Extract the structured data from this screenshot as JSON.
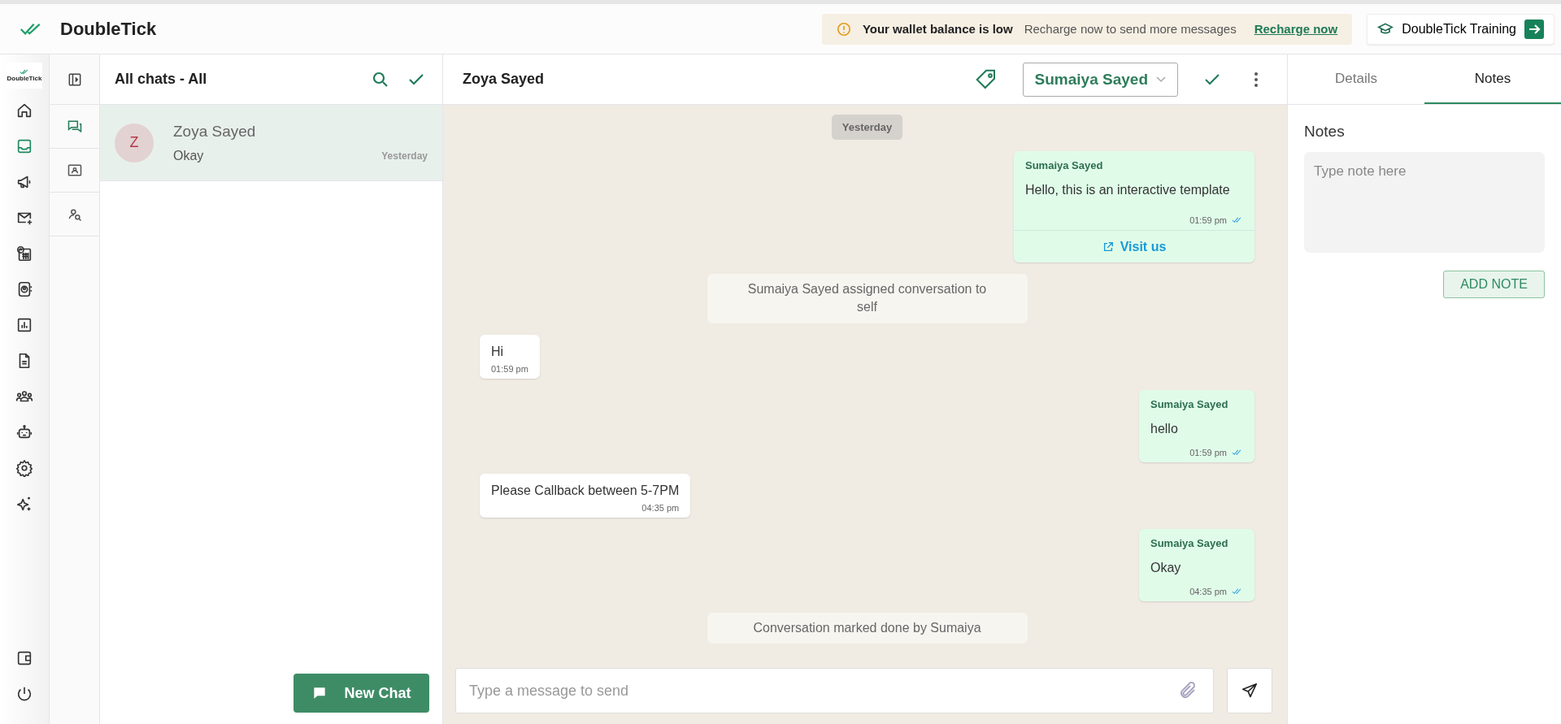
{
  "app": {
    "title": "DoubleTick",
    "logo_caption": "DoubleTick"
  },
  "banner": {
    "title": "Your wallet balance is low",
    "message": "Recharge now to send more messages",
    "link": "Recharge now"
  },
  "training_button": {
    "label": "DoubleTick Training"
  },
  "nav_rail": {
    "items": [
      {
        "selected": false
      },
      {
        "selected": true
      },
      {
        "selected": false
      },
      {
        "selected": false
      },
      {
        "selected": false
      },
      {
        "selected": false
      },
      {
        "selected": false
      },
      {
        "selected": false
      },
      {
        "selected": false
      },
      {
        "selected": false
      },
      {
        "selected": false
      },
      {
        "selected": false
      }
    ],
    "bottom_items": [
      {
        "selected": false
      },
      {
        "selected": false
      }
    ]
  },
  "sub_rail": {
    "items": [
      {
        "selected": true
      },
      {
        "selected": false
      },
      {
        "selected": false
      }
    ]
  },
  "chat_list": {
    "title": "All chats - All",
    "chats": [
      {
        "initial": "Z",
        "name": "Zoya Sayed",
        "preview": "Okay",
        "time": "Yesterday",
        "selected": true
      }
    ],
    "new_chat": "New Chat"
  },
  "conversation": {
    "contact": "Zoya Sayed",
    "assignee": "Sumaiya Sayed",
    "messages": [
      {
        "kind": "date",
        "text": "Yesterday"
      },
      {
        "kind": "outgoing",
        "sender": "Sumaiya Sayed",
        "text": "Hello, this is an interactive template",
        "time": "01:59 pm",
        "button": "Visit us"
      },
      {
        "kind": "system",
        "text": "Sumaiya Sayed assigned conversation to self"
      },
      {
        "kind": "incoming",
        "text": "Hi",
        "time": "01:59 pm"
      },
      {
        "kind": "outgoing",
        "sender": "Sumaiya Sayed",
        "text": "hello",
        "time": "01:59 pm"
      },
      {
        "kind": "incoming",
        "text": "Please Callback between 5-7PM",
        "time": "04:35 pm"
      },
      {
        "kind": "outgoing",
        "sender": "Sumaiya Sayed",
        "text": "Okay",
        "time": "04:35 pm"
      },
      {
        "kind": "system",
        "text": "Conversation marked done by Sumaiya"
      }
    ],
    "composer": {
      "placeholder": "Type a message to send"
    }
  },
  "side_panel": {
    "tabs": [
      {
        "label": "Details",
        "selected": false
      },
      {
        "label": "Notes",
        "selected": true
      }
    ],
    "heading": "Notes",
    "note": {
      "placeholder": "Type note here"
    },
    "add_button": "ADD NOTE"
  }
}
